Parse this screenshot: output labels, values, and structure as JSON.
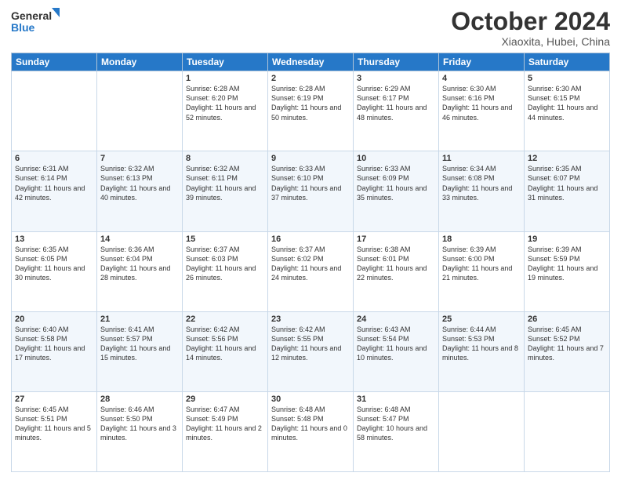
{
  "logo": {
    "line1": "General",
    "line2": "Blue"
  },
  "title": "October 2024",
  "subtitle": "Xiaoxita, Hubei, China",
  "days_of_week": [
    "Sunday",
    "Monday",
    "Tuesday",
    "Wednesday",
    "Thursday",
    "Friday",
    "Saturday"
  ],
  "weeks": [
    [
      {
        "day": "",
        "sunrise": "",
        "sunset": "",
        "daylight": ""
      },
      {
        "day": "",
        "sunrise": "",
        "sunset": "",
        "daylight": ""
      },
      {
        "day": "1",
        "sunrise": "Sunrise: 6:28 AM",
        "sunset": "Sunset: 6:20 PM",
        "daylight": "Daylight: 11 hours and 52 minutes."
      },
      {
        "day": "2",
        "sunrise": "Sunrise: 6:28 AM",
        "sunset": "Sunset: 6:19 PM",
        "daylight": "Daylight: 11 hours and 50 minutes."
      },
      {
        "day": "3",
        "sunrise": "Sunrise: 6:29 AM",
        "sunset": "Sunset: 6:17 PM",
        "daylight": "Daylight: 11 hours and 48 minutes."
      },
      {
        "day": "4",
        "sunrise": "Sunrise: 6:30 AM",
        "sunset": "Sunset: 6:16 PM",
        "daylight": "Daylight: 11 hours and 46 minutes."
      },
      {
        "day": "5",
        "sunrise": "Sunrise: 6:30 AM",
        "sunset": "Sunset: 6:15 PM",
        "daylight": "Daylight: 11 hours and 44 minutes."
      }
    ],
    [
      {
        "day": "6",
        "sunrise": "Sunrise: 6:31 AM",
        "sunset": "Sunset: 6:14 PM",
        "daylight": "Daylight: 11 hours and 42 minutes."
      },
      {
        "day": "7",
        "sunrise": "Sunrise: 6:32 AM",
        "sunset": "Sunset: 6:13 PM",
        "daylight": "Daylight: 11 hours and 40 minutes."
      },
      {
        "day": "8",
        "sunrise": "Sunrise: 6:32 AM",
        "sunset": "Sunset: 6:11 PM",
        "daylight": "Daylight: 11 hours and 39 minutes."
      },
      {
        "day": "9",
        "sunrise": "Sunrise: 6:33 AM",
        "sunset": "Sunset: 6:10 PM",
        "daylight": "Daylight: 11 hours and 37 minutes."
      },
      {
        "day": "10",
        "sunrise": "Sunrise: 6:33 AM",
        "sunset": "Sunset: 6:09 PM",
        "daylight": "Daylight: 11 hours and 35 minutes."
      },
      {
        "day": "11",
        "sunrise": "Sunrise: 6:34 AM",
        "sunset": "Sunset: 6:08 PM",
        "daylight": "Daylight: 11 hours and 33 minutes."
      },
      {
        "day": "12",
        "sunrise": "Sunrise: 6:35 AM",
        "sunset": "Sunset: 6:07 PM",
        "daylight": "Daylight: 11 hours and 31 minutes."
      }
    ],
    [
      {
        "day": "13",
        "sunrise": "Sunrise: 6:35 AM",
        "sunset": "Sunset: 6:05 PM",
        "daylight": "Daylight: 11 hours and 30 minutes."
      },
      {
        "day": "14",
        "sunrise": "Sunrise: 6:36 AM",
        "sunset": "Sunset: 6:04 PM",
        "daylight": "Daylight: 11 hours and 28 minutes."
      },
      {
        "day": "15",
        "sunrise": "Sunrise: 6:37 AM",
        "sunset": "Sunset: 6:03 PM",
        "daylight": "Daylight: 11 hours and 26 minutes."
      },
      {
        "day": "16",
        "sunrise": "Sunrise: 6:37 AM",
        "sunset": "Sunset: 6:02 PM",
        "daylight": "Daylight: 11 hours and 24 minutes."
      },
      {
        "day": "17",
        "sunrise": "Sunrise: 6:38 AM",
        "sunset": "Sunset: 6:01 PM",
        "daylight": "Daylight: 11 hours and 22 minutes."
      },
      {
        "day": "18",
        "sunrise": "Sunrise: 6:39 AM",
        "sunset": "Sunset: 6:00 PM",
        "daylight": "Daylight: 11 hours and 21 minutes."
      },
      {
        "day": "19",
        "sunrise": "Sunrise: 6:39 AM",
        "sunset": "Sunset: 5:59 PM",
        "daylight": "Daylight: 11 hours and 19 minutes."
      }
    ],
    [
      {
        "day": "20",
        "sunrise": "Sunrise: 6:40 AM",
        "sunset": "Sunset: 5:58 PM",
        "daylight": "Daylight: 11 hours and 17 minutes."
      },
      {
        "day": "21",
        "sunrise": "Sunrise: 6:41 AM",
        "sunset": "Sunset: 5:57 PM",
        "daylight": "Daylight: 11 hours and 15 minutes."
      },
      {
        "day": "22",
        "sunrise": "Sunrise: 6:42 AM",
        "sunset": "Sunset: 5:56 PM",
        "daylight": "Daylight: 11 hours and 14 minutes."
      },
      {
        "day": "23",
        "sunrise": "Sunrise: 6:42 AM",
        "sunset": "Sunset: 5:55 PM",
        "daylight": "Daylight: 11 hours and 12 minutes."
      },
      {
        "day": "24",
        "sunrise": "Sunrise: 6:43 AM",
        "sunset": "Sunset: 5:54 PM",
        "daylight": "Daylight: 11 hours and 10 minutes."
      },
      {
        "day": "25",
        "sunrise": "Sunrise: 6:44 AM",
        "sunset": "Sunset: 5:53 PM",
        "daylight": "Daylight: 11 hours and 8 minutes."
      },
      {
        "day": "26",
        "sunrise": "Sunrise: 6:45 AM",
        "sunset": "Sunset: 5:52 PM",
        "daylight": "Daylight: 11 hours and 7 minutes."
      }
    ],
    [
      {
        "day": "27",
        "sunrise": "Sunrise: 6:45 AM",
        "sunset": "Sunset: 5:51 PM",
        "daylight": "Daylight: 11 hours and 5 minutes."
      },
      {
        "day": "28",
        "sunrise": "Sunrise: 6:46 AM",
        "sunset": "Sunset: 5:50 PM",
        "daylight": "Daylight: 11 hours and 3 minutes."
      },
      {
        "day": "29",
        "sunrise": "Sunrise: 6:47 AM",
        "sunset": "Sunset: 5:49 PM",
        "daylight": "Daylight: 11 hours and 2 minutes."
      },
      {
        "day": "30",
        "sunrise": "Sunrise: 6:48 AM",
        "sunset": "Sunset: 5:48 PM",
        "daylight": "Daylight: 11 hours and 0 minutes."
      },
      {
        "day": "31",
        "sunrise": "Sunrise: 6:48 AM",
        "sunset": "Sunset: 5:47 PM",
        "daylight": "Daylight: 10 hours and 58 minutes."
      },
      {
        "day": "",
        "sunrise": "",
        "sunset": "",
        "daylight": ""
      },
      {
        "day": "",
        "sunrise": "",
        "sunset": "",
        "daylight": ""
      }
    ]
  ]
}
